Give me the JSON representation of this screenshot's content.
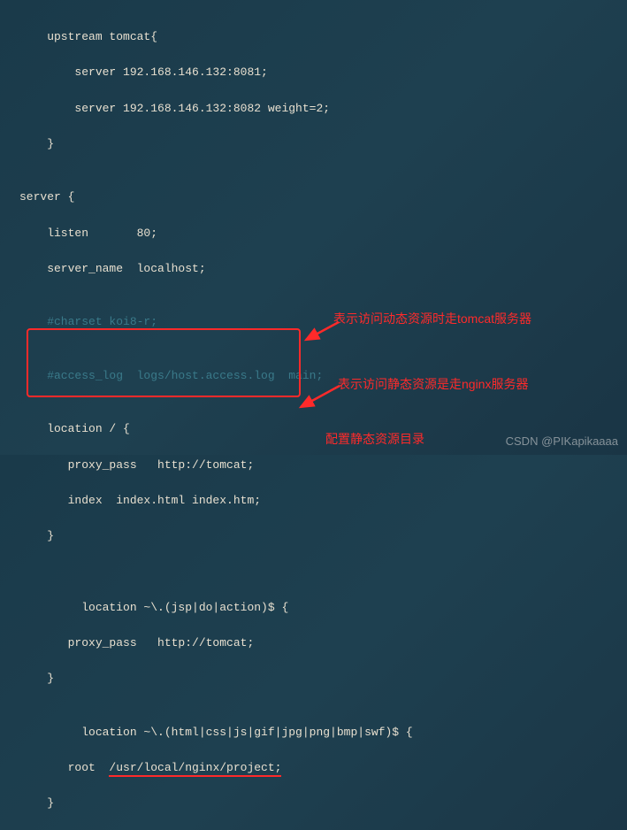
{
  "code": {
    "l1": "    upstream tomcat{",
    "l2": "        server 192.168.146.132:8081;",
    "l3": "        server 192.168.146.132:8082 weight=2;",
    "l4": "    }",
    "l5": "",
    "l6": "server {",
    "l7": "    listen       80;",
    "l8": "    server_name  localhost;",
    "l9": "",
    "l10": "    #charset koi8-r;",
    "l11": "",
    "l12": "    #access_log  logs/host.access.log  main;",
    "l13": "",
    "l14": "    location / {",
    "l15": "       proxy_pass   http://tomcat;",
    "l16": "       index  index.html index.htm;",
    "l17": "    }",
    "l18": "",
    "l19": "",
    "l20": "         location ~\\.(jsp|do|action)$ {",
    "l21": "       proxy_pass   http://tomcat;",
    "l22": "    }",
    "l23": "",
    "l24_a": "         location ~\\.(html|css|js|gif|jpg|png|bmp|swf)$ {",
    "l24_root_label": "       root  ",
    "l24_root_path": "/usr/local/nginx/project;",
    "l25": "    }"
  },
  "annotations": {
    "dynamic": "表示访问动态资源时走tomcat服务器",
    "static": "表示访问静态资源是走nginx服务器",
    "rootdir": "配置静态资源目录"
  },
  "watermark": "CSDN @PIKapikaaaa"
}
